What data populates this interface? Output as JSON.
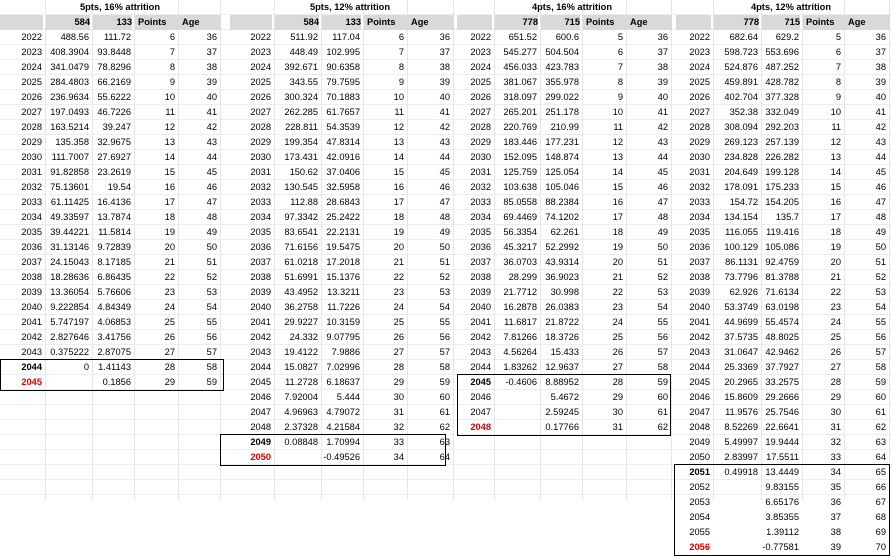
{
  "tables": [
    {
      "title": "5pts, 16% attrition",
      "headers": [
        "",
        "584",
        "133",
        "Points",
        "Age"
      ],
      "rows": [
        [
          "2022",
          "488.56",
          "111.72",
          "6",
          "36"
        ],
        [
          "2023",
          "408.3904",
          "93.8448",
          "7",
          "37"
        ],
        [
          "2024",
          "341.0479",
          "78.8296",
          "8",
          "38"
        ],
        [
          "2025",
          "284.4803",
          "66.2169",
          "9",
          "39"
        ],
        [
          "2026",
          "236.9634",
          "55.6222",
          "10",
          "40"
        ],
        [
          "2027",
          "197.0493",
          "46.7226",
          "11",
          "41"
        ],
        [
          "2028",
          "163.5214",
          "39.247",
          "12",
          "42"
        ],
        [
          "2029",
          "135.358",
          "32.9675",
          "13",
          "43"
        ],
        [
          "2030",
          "111.7007",
          "27.6927",
          "14",
          "44"
        ],
        [
          "2031",
          "91.82858",
          "23.2619",
          "15",
          "45"
        ],
        [
          "2032",
          "75.13601",
          "19.54",
          "16",
          "46"
        ],
        [
          "2033",
          "61.11425",
          "16.4136",
          "17",
          "47"
        ],
        [
          "2034",
          "49.33597",
          "13.7874",
          "18",
          "48"
        ],
        [
          "2035",
          "39.44221",
          "11.5814",
          "19",
          "49"
        ],
        [
          "2036",
          "31.13146",
          "9.72839",
          "20",
          "50"
        ],
        [
          "2037",
          "24.15043",
          "8.17185",
          "21",
          "51"
        ],
        [
          "2038",
          "18.28636",
          "6.86435",
          "22",
          "52"
        ],
        [
          "2039",
          "13.36054",
          "5.76606",
          "23",
          "53"
        ],
        [
          "2040",
          "9.222854",
          "4.84349",
          "24",
          "54"
        ],
        [
          "2041",
          "5.747197",
          "4.06853",
          "25",
          "55"
        ],
        [
          "2042",
          "2.827646",
          "3.41756",
          "26",
          "56"
        ],
        [
          "2043",
          "0.375222",
          "2.87075",
          "27",
          "57"
        ],
        [
          "2044",
          "0",
          "1.41143",
          "28",
          "58"
        ],
        [
          "2045",
          "",
          "0.1856",
          "29",
          "59"
        ]
      ],
      "bold_years": [
        "2044"
      ],
      "red_years": [
        "2045"
      ]
    },
    {
      "title": "5pts, 12% attrition",
      "headers": [
        "",
        "584",
        "133",
        "Points",
        "Age"
      ],
      "rows": [
        [
          "2022",
          "511.92",
          "117.04",
          "6",
          "36"
        ],
        [
          "2023",
          "448.49",
          "102.995",
          "7",
          "37"
        ],
        [
          "2024",
          "392.671",
          "90.6358",
          "8",
          "38"
        ],
        [
          "2025",
          "343.55",
          "79.7595",
          "9",
          "39"
        ],
        [
          "2026",
          "300.324",
          "70.1883",
          "10",
          "40"
        ],
        [
          "2027",
          "262.285",
          "61.7657",
          "11",
          "41"
        ],
        [
          "2028",
          "228.811",
          "54.3539",
          "12",
          "42"
        ],
        [
          "2029",
          "199.354",
          "47.8314",
          "13",
          "43"
        ],
        [
          "2030",
          "173.431",
          "42.0916",
          "14",
          "44"
        ],
        [
          "2031",
          "150.62",
          "37.0406",
          "15",
          "45"
        ],
        [
          "2032",
          "130.545",
          "32.5958",
          "16",
          "46"
        ],
        [
          "2033",
          "112.88",
          "28.6843",
          "17",
          "47"
        ],
        [
          "2034",
          "97.3342",
          "25.2422",
          "18",
          "48"
        ],
        [
          "2035",
          "83.6541",
          "22.2131",
          "19",
          "49"
        ],
        [
          "2036",
          "71.6156",
          "19.5475",
          "20",
          "50"
        ],
        [
          "2037",
          "61.0218",
          "17.2018",
          "21",
          "51"
        ],
        [
          "2038",
          "51.6991",
          "15.1376",
          "22",
          "52"
        ],
        [
          "2039",
          "43.4952",
          "13.3211",
          "23",
          "53"
        ],
        [
          "2040",
          "36.2758",
          "11.7226",
          "24",
          "54"
        ],
        [
          "2041",
          "29.9227",
          "10.3159",
          "25",
          "55"
        ],
        [
          "2042",
          "24.332",
          "9.07795",
          "26",
          "56"
        ],
        [
          "2043",
          "19.4122",
          "7.9886",
          "27",
          "57"
        ],
        [
          "2044",
          "15.0827",
          "7.02996",
          "28",
          "58"
        ],
        [
          "2045",
          "11.2728",
          "6.18637",
          "29",
          "59"
        ],
        [
          "2046",
          "7.92004",
          "5.444",
          "30",
          "60"
        ],
        [
          "2047",
          "4.96963",
          "4.79072",
          "31",
          "61"
        ],
        [
          "2048",
          "2.37328",
          "4.21584",
          "32",
          "62"
        ],
        [
          "2049",
          "0.08848",
          "1.70994",
          "33",
          "63"
        ],
        [
          "2050",
          "",
          "-0.49526",
          "34",
          "64"
        ]
      ],
      "bold_years": [
        "2049"
      ],
      "red_years": [
        "2050"
      ]
    },
    {
      "title": "4pts, 16% attrition",
      "headers": [
        "",
        "778",
        "715",
        "Points",
        "Age"
      ],
      "rows": [
        [
          "2022",
          "651.52",
          "600.6",
          "5",
          "36"
        ],
        [
          "2023",
          "545.277",
          "504.504",
          "6",
          "37"
        ],
        [
          "2024",
          "456.033",
          "423.783",
          "7",
          "38"
        ],
        [
          "2025",
          "381.067",
          "355.978",
          "8",
          "39"
        ],
        [
          "2026",
          "318.097",
          "299.022",
          "9",
          "40"
        ],
        [
          "2027",
          "265.201",
          "251.178",
          "10",
          "41"
        ],
        [
          "2028",
          "220.769",
          "210.99",
          "11",
          "42"
        ],
        [
          "2029",
          "183.446",
          "177.231",
          "12",
          "43"
        ],
        [
          "2030",
          "152.095",
          "148.874",
          "13",
          "44"
        ],
        [
          "2031",
          "125.759",
          "125.054",
          "14",
          "45"
        ],
        [
          "2032",
          "103.638",
          "105.046",
          "15",
          "46"
        ],
        [
          "2033",
          "85.0558",
          "88.2384",
          "16",
          "47"
        ],
        [
          "2034",
          "69.4469",
          "74.1202",
          "17",
          "48"
        ],
        [
          "2035",
          "56.3354",
          "62.261",
          "18",
          "49"
        ],
        [
          "2036",
          "45.3217",
          "52.2992",
          "19",
          "50"
        ],
        [
          "2037",
          "36.0703",
          "43.9314",
          "20",
          "51"
        ],
        [
          "2038",
          "28.299",
          "36.9023",
          "21",
          "52"
        ],
        [
          "2039",
          "21.7712",
          "30.998",
          "22",
          "53"
        ],
        [
          "2040",
          "16.2878",
          "26.0383",
          "23",
          "54"
        ],
        [
          "2041",
          "11.6817",
          "21.8722",
          "24",
          "55"
        ],
        [
          "2042",
          "7.81266",
          "18.3726",
          "25",
          "56"
        ],
        [
          "2043",
          "4.56264",
          "15.433",
          "26",
          "57"
        ],
        [
          "2044",
          "1.83262",
          "12.9637",
          "27",
          "58"
        ],
        [
          "2045",
          "-0.4606",
          "8.88952",
          "28",
          "59"
        ],
        [
          "2046",
          "",
          "5.4672",
          "29",
          "60"
        ],
        [
          "2047",
          "",
          "2.59245",
          "30",
          "61"
        ],
        [
          "2048",
          "",
          "0.17766",
          "31",
          "62"
        ]
      ],
      "bold_years": [
        "2045"
      ],
      "red_years": [
        "2048"
      ]
    },
    {
      "title": "4pts, 12% attrition",
      "headers": [
        "",
        "778",
        "715",
        "Points",
        "Age"
      ],
      "rows": [
        [
          "2022",
          "682.64",
          "629.2",
          "5",
          "36"
        ],
        [
          "2023",
          "598.723",
          "553.696",
          "6",
          "37"
        ],
        [
          "2024",
          "524.876",
          "487.252",
          "7",
          "38"
        ],
        [
          "2025",
          "459.891",
          "428.782",
          "8",
          "39"
        ],
        [
          "2026",
          "402.704",
          "377.328",
          "9",
          "40"
        ],
        [
          "2027",
          "352.38",
          "332.049",
          "10",
          "41"
        ],
        [
          "2028",
          "308.094",
          "292.203",
          "11",
          "42"
        ],
        [
          "2029",
          "269.123",
          "257.139",
          "12",
          "43"
        ],
        [
          "2030",
          "234.828",
          "226.282",
          "13",
          "44"
        ],
        [
          "2031",
          "204.649",
          "199.128",
          "14",
          "45"
        ],
        [
          "2032",
          "178.091",
          "175.233",
          "15",
          "46"
        ],
        [
          "2033",
          "154.72",
          "154.205",
          "16",
          "47"
        ],
        [
          "2034",
          "134.154",
          "135.7",
          "17",
          "48"
        ],
        [
          "2035",
          "116.055",
          "119.416",
          "18",
          "49"
        ],
        [
          "2036",
          "100.129",
          "105.086",
          "19",
          "50"
        ],
        [
          "2037",
          "86.1131",
          "92.4759",
          "20",
          "51"
        ],
        [
          "2038",
          "73.7796",
          "81.3788",
          "21",
          "52"
        ],
        [
          "2039",
          "62.926",
          "71.6134",
          "22",
          "53"
        ],
        [
          "2040",
          "53.3749",
          "63.0198",
          "23",
          "54"
        ],
        [
          "2041",
          "44.9699",
          "55.4574",
          "24",
          "55"
        ],
        [
          "2042",
          "37.5735",
          "48.8025",
          "25",
          "56"
        ],
        [
          "2043",
          "31.0647",
          "42.9462",
          "26",
          "57"
        ],
        [
          "2044",
          "25.3369",
          "37.7927",
          "27",
          "58"
        ],
        [
          "2045",
          "20.2965",
          "33.2575",
          "28",
          "59"
        ],
        [
          "2046",
          "15.8609",
          "29.2666",
          "29",
          "60"
        ],
        [
          "2047",
          "11.9576",
          "25.7546",
          "30",
          "61"
        ],
        [
          "2048",
          "8.52269",
          "22.6641",
          "31",
          "62"
        ],
        [
          "2049",
          "5.49997",
          "19.9444",
          "32",
          "63"
        ],
        [
          "2050",
          "2.83997",
          "17.5511",
          "33",
          "64"
        ],
        [
          "2051",
          "0.49918",
          "13.4449",
          "34",
          "65"
        ],
        [
          "2052",
          "",
          "9.83155",
          "35",
          "66"
        ],
        [
          "2053",
          "",
          "6.65176",
          "36",
          "67"
        ],
        [
          "2054",
          "",
          "3.85355",
          "37",
          "68"
        ],
        [
          "2055",
          "",
          "1.39112",
          "38",
          "69"
        ],
        [
          "2056",
          "",
          "-0.77581",
          "39",
          "70"
        ]
      ],
      "bold_years": [
        "2051"
      ],
      "red_years": [
        "2056"
      ]
    }
  ]
}
